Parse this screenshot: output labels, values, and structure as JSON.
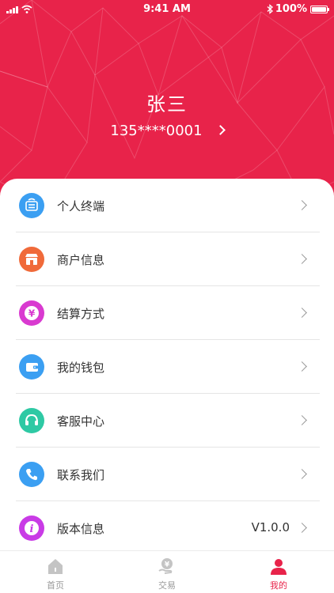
{
  "status_bar": {
    "time": "9:41 AM",
    "battery": "100%"
  },
  "profile": {
    "name": "张三",
    "phone": "135****0001"
  },
  "menu": [
    {
      "label": "个人终端",
      "icon": "terminal-icon",
      "color": "#3b9ff2"
    },
    {
      "label": "商户信息",
      "icon": "store-icon",
      "color": "#f06a3a"
    },
    {
      "label": "结算方式",
      "icon": "yuan-coin-icon",
      "color": "#d93ad0"
    },
    {
      "label": "我的钱包",
      "icon": "wallet-icon",
      "color": "#3b9ff2"
    },
    {
      "label": "客服中心",
      "icon": "headset-icon",
      "color": "#2ec9a4"
    },
    {
      "label": "联系我们",
      "icon": "phone-icon",
      "color": "#3b9ff2"
    },
    {
      "label": "版本信息",
      "icon": "info-icon",
      "color": "#c93be6",
      "value": "V1.0.0"
    }
  ],
  "tabbar": [
    {
      "label": "首页",
      "icon": "home-icon",
      "active": false
    },
    {
      "label": "交易",
      "icon": "transaction-icon",
      "active": false
    },
    {
      "label": "我的",
      "icon": "user-icon",
      "active": true
    }
  ],
  "colors": {
    "brand_red": "#e8234a",
    "tab_inactive": "#999999"
  }
}
